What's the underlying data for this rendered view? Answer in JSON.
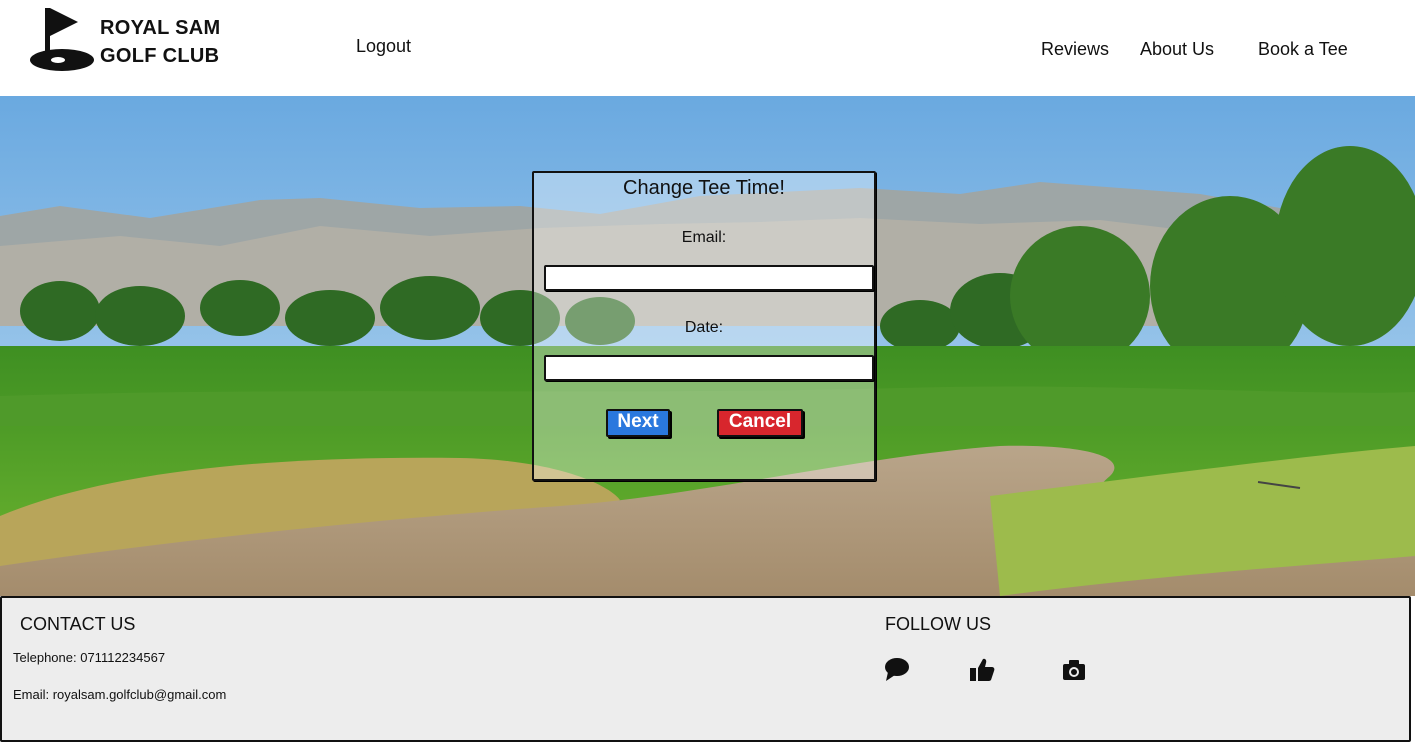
{
  "header": {
    "brand_line1": "ROYAL SAM",
    "brand_line2": "GOLF CLUB",
    "logout": "Logout",
    "nav": {
      "reviews": "Reviews",
      "about": "About Us",
      "book": "Book a Tee"
    }
  },
  "modal": {
    "title": "Change Tee Time!",
    "email_label": "Email:",
    "email_value": "",
    "date_label": "Date:",
    "date_value": "",
    "next_label": "Next",
    "cancel_label": "Cancel"
  },
  "footer": {
    "contact_heading": "CONTACT US",
    "telephone": "Telephone: 071112234567",
    "email": "Email: royalsam.golfclub@gmail.com",
    "follow_heading": "FOLLOW US",
    "social_icons": [
      "chat-bubble-icon",
      "thumbs-up-icon",
      "camera-icon"
    ]
  },
  "colors": {
    "next_button": "#2a78de",
    "cancel_button": "#d8262d",
    "footer_bg": "#ededed"
  }
}
